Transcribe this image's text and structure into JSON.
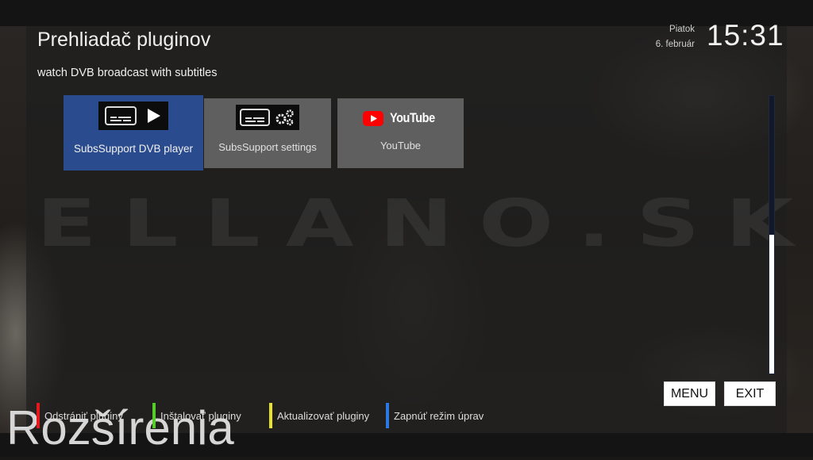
{
  "header": {
    "title": "Prehliadač pluginov",
    "description": "watch DVB broadcast with subtitles",
    "day": "Piatok",
    "date": "6. február",
    "time": "15:31"
  },
  "watermark": "ELLANO.SK",
  "background_text": "Rozšírenia",
  "plugins": [
    {
      "label": "SubsSupport DVB player",
      "icon": "subtitle-play-icon",
      "selected": true
    },
    {
      "label": "SubsSupport settings",
      "icon": "subtitle-settings-icon",
      "selected": false
    },
    {
      "label": "YouTube",
      "icon": "youtube-logo",
      "logo_text": "YouTube",
      "selected": false
    }
  ],
  "scroll_position_fraction": 0.5,
  "buttons": {
    "menu": "MENU",
    "exit": "EXIT"
  },
  "hints": [
    {
      "label": "Odstrániť pluginy",
      "color": "#e3191c"
    },
    {
      "label": "Inštalovať pluginy",
      "color": "#55cc2a"
    },
    {
      "label": "Aktualizovať pluginy",
      "color": "#e6e22a"
    },
    {
      "label": "Zapnúť režim úprav",
      "color": "#2a78e0"
    }
  ],
  "colors": {
    "selected_tile": "#2a4b8d",
    "tile": "#5f5f5f",
    "youtube_red": "#ff0000"
  }
}
